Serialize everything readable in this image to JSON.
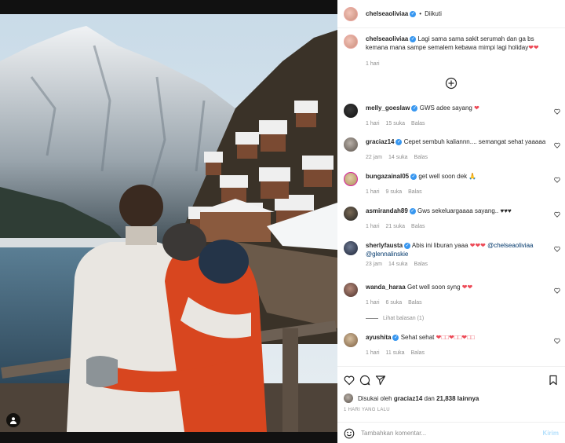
{
  "post": {
    "username": "chelseaoliviaa",
    "follow_dot": "•",
    "follow_label": "Diikuti",
    "caption": "Lagi sama sama sakit serumah dan ga bs kemana mana sampe semalem kebawa mimpi lagi holiday",
    "caption_emoji": "❤❤",
    "caption_time": "1 hari"
  },
  "comments": [
    {
      "name": "melly_goeslaw",
      "verified": true,
      "text": "GWS adee sayang",
      "emoji": "❤",
      "time": "1 hari",
      "likes": "15 suka",
      "reply": "Balas"
    },
    {
      "name": "graciaz14",
      "verified": true,
      "text": "Cepet sembuh kaliannn.... semangat sehat yaaaaa",
      "emoji": "",
      "time": "22 jam",
      "likes": "14 suka",
      "reply": "Balas"
    },
    {
      "name": "bungazainal05",
      "verified": true,
      "text": "get well soon dek",
      "emoji": "🙏",
      "time": "1 hari",
      "likes": "9 suka",
      "reply": "Balas"
    },
    {
      "name": "asmirandah89",
      "verified": true,
      "text": "Gws sekeluargaaaa sayang..",
      "emoji": "♥♥♥",
      "time": "1 hari",
      "likes": "21 suka",
      "reply": "Balas"
    },
    {
      "name": "sherlyfausta",
      "verified": true,
      "text": "Abis ini liburan yaaa",
      "emoji": "❤❤❤",
      "mention1": "@chelseaoliviaa",
      "mention2": "@glennalinskie",
      "time": "23 jam",
      "likes": "14 suka",
      "reply": "Balas"
    },
    {
      "name": "wanda_haraa",
      "verified": false,
      "text": "Get well soon syng",
      "emoji": "❤❤",
      "time": "1 hari",
      "likes": "6 suka",
      "reply": "Balas",
      "view_replies": "Lihat balasan (1)"
    },
    {
      "name": "ayushita",
      "verified": true,
      "text": "Sehat sehat",
      "emoji": "❤□□❤□□❤□□",
      "time": "1 hari",
      "likes": "11 suka",
      "reply": "Balas"
    }
  ],
  "likes": {
    "prefix": "Disukai oleh",
    "user": "graciaz14",
    "connector": "dan",
    "others": "21,838 lainnya"
  },
  "timestamp": "1 HARI YANG LALU",
  "add_comment": {
    "placeholder": "Tambahkan komentar...",
    "post_label": "Kirim"
  },
  "icons": {
    "verified": "verified-badge-icon",
    "heart": "heart-outline-icon",
    "comment": "comment-icon",
    "share": "paper-plane-icon",
    "save": "bookmark-icon",
    "emoji": "smiley-icon",
    "load_more": "plus-circle-icon",
    "user_tag": "user-icon"
  },
  "colors": {
    "verified": "#3897f0",
    "heart_red": "#ed4956",
    "mention": "#00376b",
    "muted": "#8e8e8e",
    "post_button_disabled": "#b2dffc"
  }
}
